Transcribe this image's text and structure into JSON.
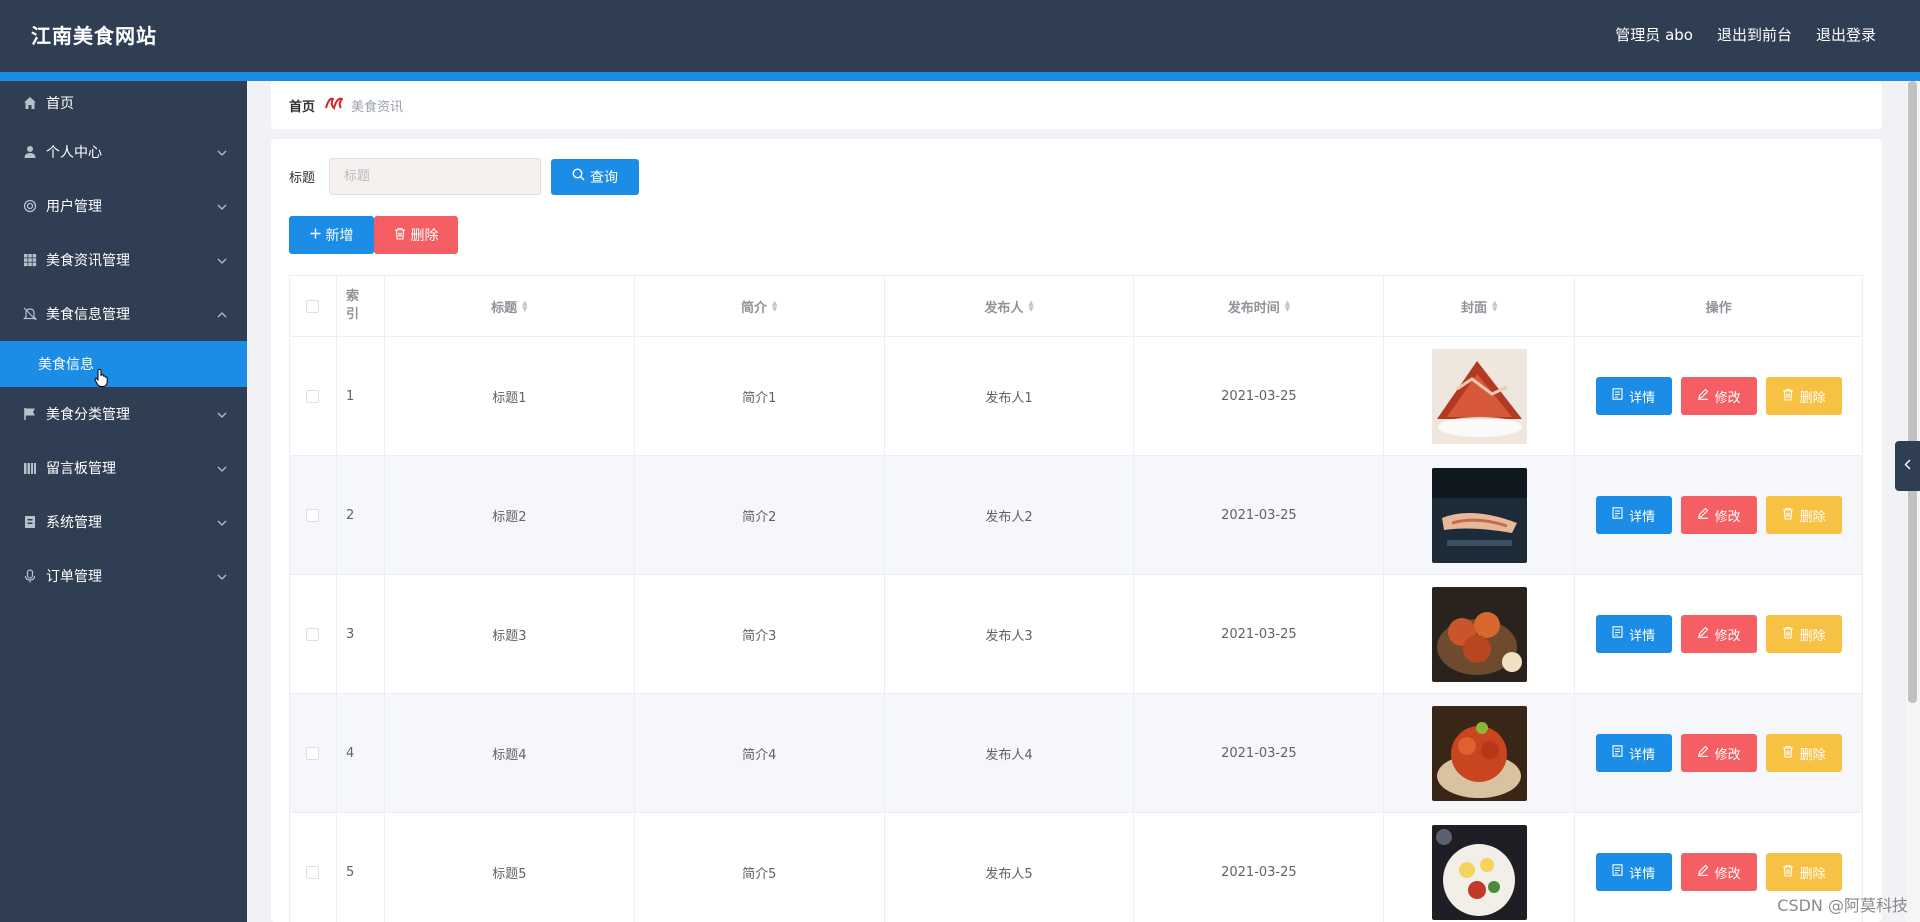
{
  "header": {
    "logo": "江南美食网站",
    "admin": "管理员 abo",
    "back_front": "退出到前台",
    "logout": "退出登录"
  },
  "sidebar": {
    "items": [
      {
        "label": "首页",
        "icon": "home-icon",
        "expandable": false
      },
      {
        "label": "个人中心",
        "icon": "user-icon",
        "expandable": true
      },
      {
        "label": "用户管理",
        "icon": "circle-icon",
        "expandable": true
      },
      {
        "label": "美食资讯管理",
        "icon": "grid-icon",
        "expandable": true
      },
      {
        "label": "美食信息管理",
        "icon": "bell-icon",
        "expandable": true,
        "expanded": true
      },
      {
        "label": "美食分类管理",
        "icon": "flag-icon",
        "expandable": true
      },
      {
        "label": "留言板管理",
        "icon": "bars-icon",
        "expandable": true
      },
      {
        "label": "系统管理",
        "icon": "box-icon",
        "expandable": true
      },
      {
        "label": "订单管理",
        "icon": "mic-icon",
        "expandable": true
      }
    ],
    "active_sub": "美食信息"
  },
  "breadcrumb": {
    "home": "首页",
    "current": "美食资讯"
  },
  "search": {
    "label": "标题",
    "placeholder": "标题",
    "value": "",
    "button": "查询"
  },
  "actions": {
    "add": "新增",
    "delete": "删除"
  },
  "table": {
    "headers": {
      "index": "索引",
      "title": "标题",
      "intro": "简介",
      "publisher": "发布人",
      "time": "发布时间",
      "cover": "封面",
      "ops": "操作"
    },
    "rows": [
      {
        "index": "1",
        "title": "标题1",
        "intro": "简介1",
        "publisher": "发布人1",
        "time": "2021-03-25"
      },
      {
        "index": "2",
        "title": "标题2",
        "intro": "简介2",
        "publisher": "发布人2",
        "time": "2021-03-25"
      },
      {
        "index": "3",
        "title": "标题3",
        "intro": "简介3",
        "publisher": "发布人3",
        "time": "2021-03-25"
      },
      {
        "index": "4",
        "title": "标题4",
        "intro": "简介4",
        "publisher": "发布人4",
        "time": "2021-03-25"
      },
      {
        "index": "5",
        "title": "标题5",
        "intro": "简介5",
        "publisher": "发布人5",
        "time": "2021-03-25"
      }
    ],
    "op_labels": {
      "detail": "详情",
      "edit": "修改",
      "delete": "删除"
    }
  },
  "watermark": "CSDN @阿莫科技",
  "colors": {
    "header_bg": "#2f3e52",
    "primary": "#1c8de6",
    "danger": "#f55e63",
    "warning": "#f7c143"
  }
}
